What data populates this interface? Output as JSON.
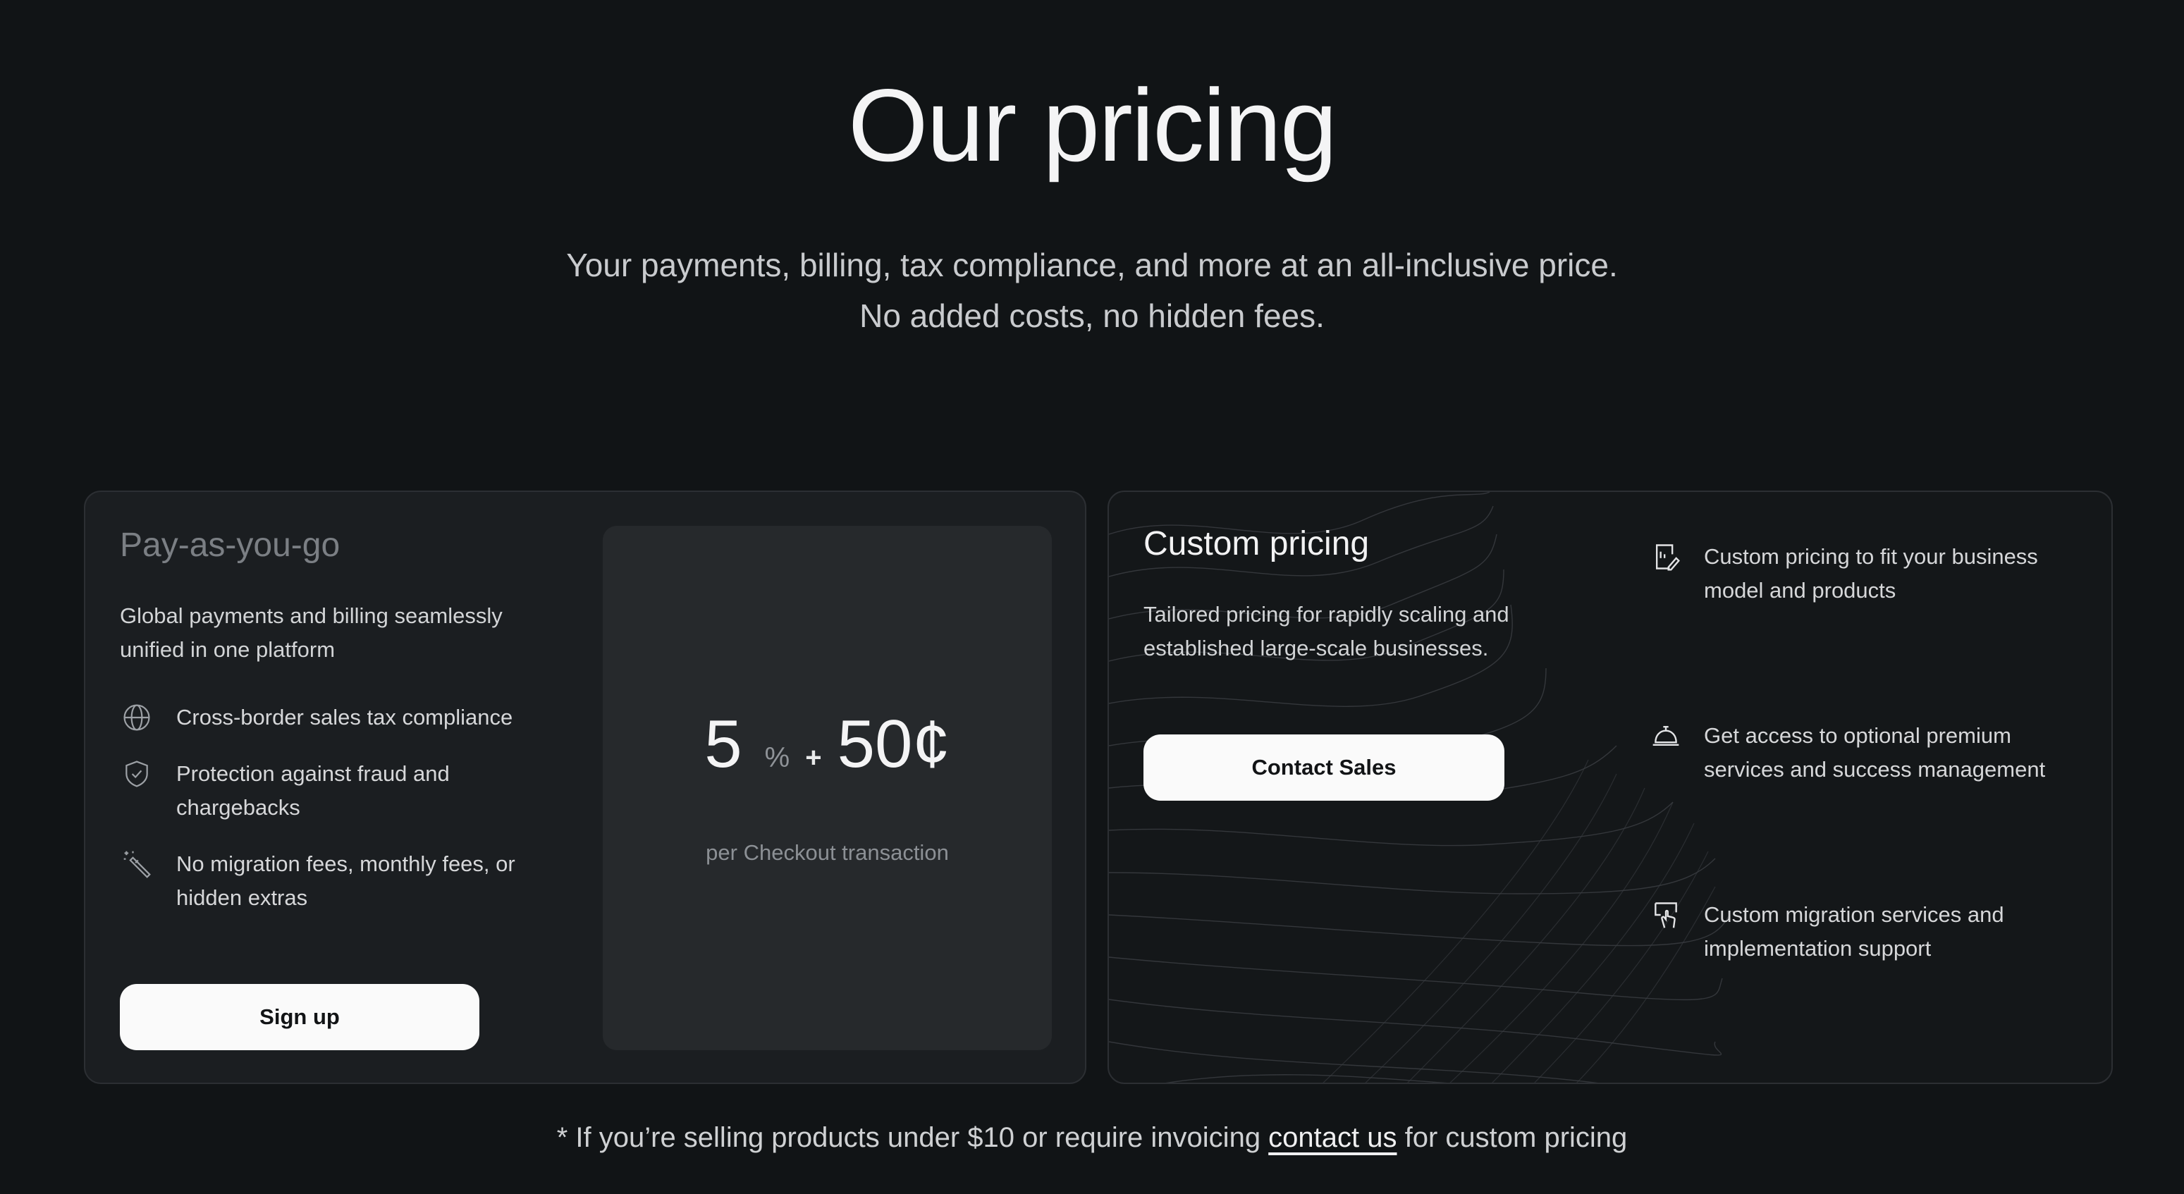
{
  "hero": {
    "title": "Our pricing",
    "subtitle_line1": "Your payments, billing, tax compliance, and more at an all-inclusive price.",
    "subtitle_line2": "No added costs, no hidden fees."
  },
  "payg": {
    "title": "Pay-as-you-go",
    "description_line1": "Global payments and billing seamlessly",
    "description_line2": "unified in one platform",
    "features": [
      {
        "icon": "globe-icon",
        "line1": "Cross-border sales tax compliance",
        "line2": ""
      },
      {
        "icon": "shield-check-icon",
        "line1": "Protection against fraud and",
        "line2": "chargebacks"
      },
      {
        "icon": "magic-wand-icon",
        "line1": "No migration fees, monthly fees, or",
        "line2": "hidden extras"
      }
    ],
    "signup_label": "Sign up",
    "price": {
      "percent_value": "5",
      "percent_sign": "%",
      "plus": "+",
      "fixed_fee": "50¢",
      "caption": "per Checkout transaction"
    }
  },
  "custom": {
    "title": "Custom pricing",
    "description_line1": "Tailored pricing for rapidly scaling and",
    "description_line2": "established large-scale businesses.",
    "contact_label": "Contact Sales",
    "features": [
      {
        "icon": "document-edit-icon",
        "line1": "Custom pricing to fit your business",
        "line2": "model and products"
      },
      {
        "icon": "service-bell-icon",
        "line1": "Get access to optional premium",
        "line2": "services and success management"
      },
      {
        "icon": "migration-pointer-icon",
        "line1": "Custom migration services and",
        "line2": "implementation support"
      }
    ]
  },
  "footnote": {
    "before": "* If you’re selling products under $10 or require invoicing ",
    "link": "contact us",
    "after": " for custom pricing"
  },
  "colors": {
    "background": "#111416",
    "card_left": "#1b1e21",
    "card_right": "#141719",
    "price_panel": "#26292c",
    "button": "#fafafa"
  }
}
